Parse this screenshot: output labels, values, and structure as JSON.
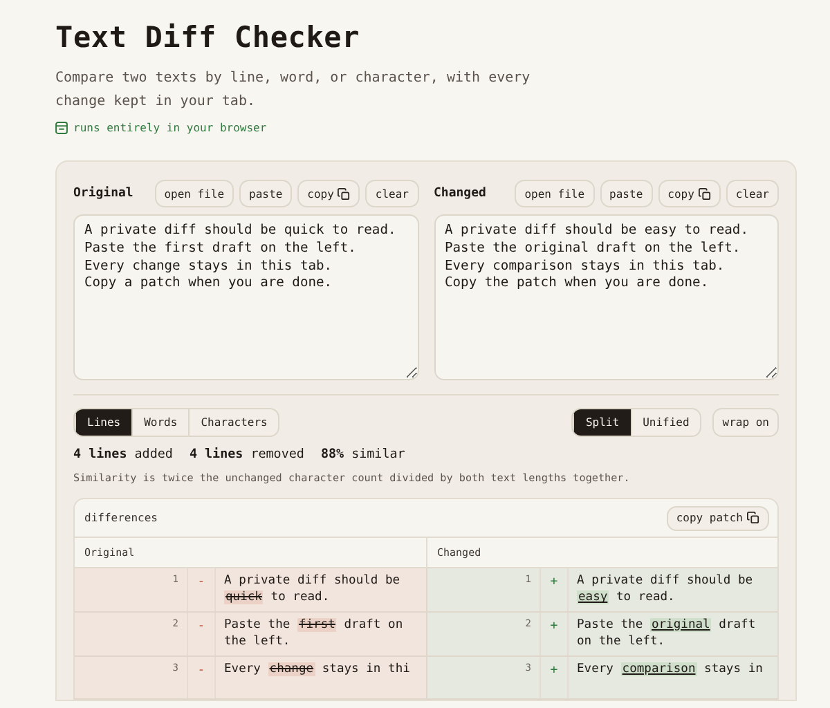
{
  "header": {
    "title": "Text Diff Checker",
    "subtitle": "Compare two texts by line, word, or character, with every change kept in your tab.",
    "badge": "runs entirely in your browser"
  },
  "editors": [
    {
      "label": "Original",
      "buttons": [
        {
          "label": "open file",
          "kind": "plain"
        },
        {
          "label": "paste",
          "kind": "plain"
        },
        {
          "label": "copy",
          "kind": "copy"
        },
        {
          "label": "clear",
          "kind": "plain"
        }
      ],
      "text": "A private diff should be quick to read.\nPaste the first draft on the left.\nEvery change stays in this tab.\nCopy a patch when you are done."
    },
    {
      "label": "Changed",
      "buttons": [
        {
          "label": "open file",
          "kind": "plain"
        },
        {
          "label": "paste",
          "kind": "plain"
        },
        {
          "label": "copy",
          "kind": "copy"
        },
        {
          "label": "clear",
          "kind": "plain"
        }
      ],
      "text": "A private diff should be easy to read.\nPaste the original draft on the left.\nEvery comparison stays in this tab.\nCopy the patch when you are done."
    }
  ],
  "modes": [
    {
      "label": "Lines",
      "selected": true
    },
    {
      "label": "Words",
      "selected": false
    },
    {
      "label": "Characters",
      "selected": false
    }
  ],
  "views": [
    {
      "label": "Split",
      "selected": true
    },
    {
      "label": "Unified",
      "selected": false
    }
  ],
  "wrap_button": "wrap on",
  "stats": [
    "**4 lines** added",
    "**4 lines** removed",
    "**88%** similar"
  ],
  "note": "Similarity is twice the unchanged character count divided by both text lengths together.",
  "differences": {
    "title": "differences",
    "copy_button": "copy patch",
    "columns": [
      "Original",
      "Changed"
    ],
    "rows": [
      {
        "left": {
          "kind": "removed",
          "number": "1",
          "sign": "-",
          "before": "A private diff should be ",
          "word": "quick",
          "after": " to read."
        },
        "right": {
          "kind": "added",
          "number": "1",
          "sign": "+",
          "before": "A private diff should be ",
          "word": "easy",
          "after": " to read."
        }
      },
      {
        "left": {
          "kind": "removed",
          "number": "2",
          "sign": "-",
          "before": "Paste the ",
          "word": "first",
          "after": " draft on the left."
        },
        "right": {
          "kind": "added",
          "number": "2",
          "sign": "+",
          "before": "Paste the ",
          "word": "original",
          "after": " draft on the left."
        }
      },
      {
        "left": {
          "kind": "removed",
          "number": "3",
          "sign": "-",
          "before": "Every ",
          "word": "change",
          "after": " stays in thi"
        },
        "right": {
          "kind": "added",
          "number": "3",
          "sign": "+",
          "before": "Every ",
          "word": "comparison",
          "after": " stays in"
        }
      }
    ]
  }
}
